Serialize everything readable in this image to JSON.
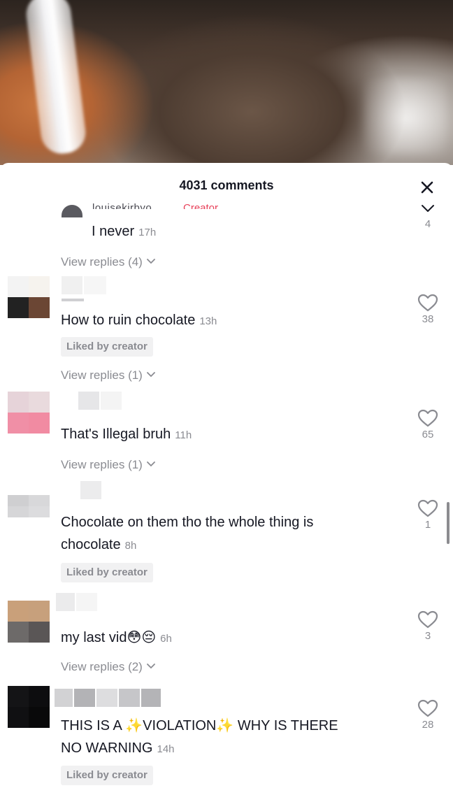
{
  "header": {
    "comment_count": "4031 comments",
    "close_icon": "close-icon"
  },
  "reply": {
    "name": "louisekirbyo",
    "badge": "Creator",
    "text": "I never",
    "time": "17h",
    "like_count": "4",
    "view_replies": "View replies (4)"
  },
  "comments": [
    {
      "text": "How to ruin chocolate",
      "time": "13h",
      "liked_by_creator": "Liked by creator",
      "view_replies": "View replies (1)",
      "like_count": "38"
    },
    {
      "text": "That's Illegal bruh",
      "time": "11h",
      "view_replies": "View replies (1)",
      "like_count": "65"
    },
    {
      "text_line1": "Chocolate on them tho the whole thing is",
      "text_line2": "chocolate",
      "time": "8h",
      "liked_by_creator": "Liked by creator",
      "like_count": "1"
    },
    {
      "text": "my last vid",
      "emoji": "😳😔",
      "time": "6h",
      "view_replies": "View replies (2)",
      "like_count": "3"
    },
    {
      "text_line1_a": "THIS IS A ",
      "sparkle": "✨",
      "text_line1_b": "VIOLATION",
      "text_line1_c": " WHY IS THERE",
      "text_line2": "NO WARNING",
      "time": "14h",
      "liked_by_creator": "Liked by creator",
      "like_count": "28"
    }
  ],
  "colors": {
    "text": "#161823",
    "muted": "#8a8b91",
    "creator_badge": "#e8415a",
    "liked_bg": "#f1f1f2"
  }
}
